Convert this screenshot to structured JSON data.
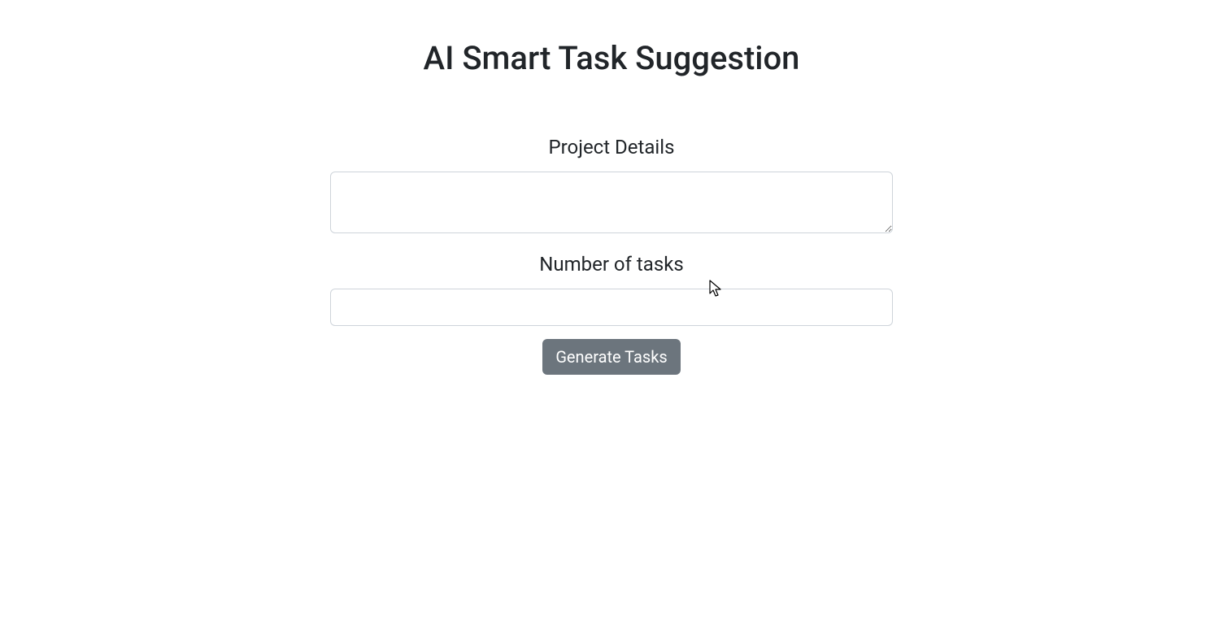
{
  "page": {
    "title": "AI Smart Task Suggestion"
  },
  "form": {
    "project_details_label": "Project Details",
    "project_details_value": "",
    "num_tasks_label": "Number of tasks",
    "num_tasks_value": "",
    "generate_button_label": "Generate Tasks"
  }
}
